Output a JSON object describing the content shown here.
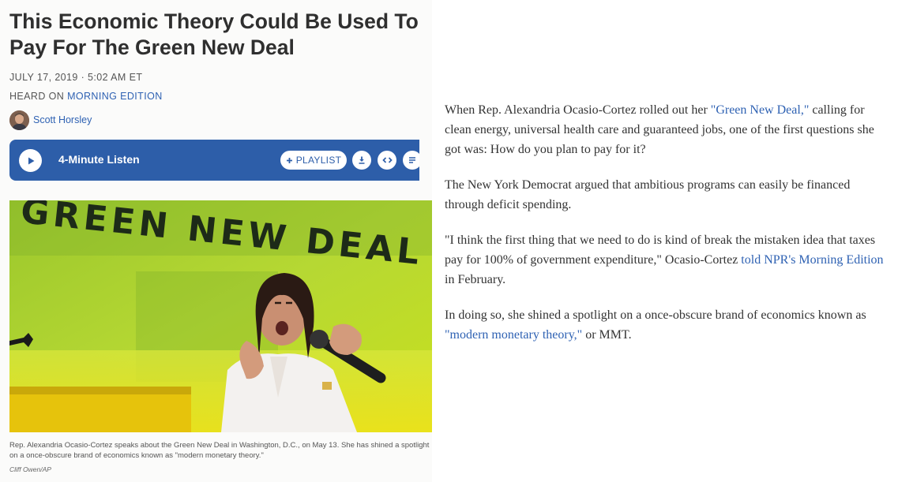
{
  "article": {
    "headline": "This Economic Theory Could Be Used To Pay For The Green New Deal",
    "dateline": "JULY 17, 2019 · 5:02 AM ET",
    "heard_on_prefix": "HEARD ON ",
    "heard_on_program": "MORNING EDITION",
    "author": "Scott Horsley"
  },
  "player": {
    "listen_label": "4-Minute Listen",
    "playlist_label": "PLAYLIST",
    "playlist_icon": "plus-icon",
    "icons": [
      "play-icon",
      "download-icon",
      "embed-icon",
      "transcript-icon"
    ]
  },
  "photo": {
    "sign_text": "GREEN NEW DEAL",
    "caption": "Rep. Alexandria Ocasio-Cortez speaks about the Green New Deal in Washington, D.C., on May 13. She has shined a spotlight on a once-obscure brand of economics known as \"modern monetary theory.\"",
    "credit": "Cliff Owen/AP"
  },
  "body": {
    "p1": {
      "before": "When Rep. Alexandria Ocasio-Cortez rolled out her ",
      "link": "\"Green New Deal,\"",
      "after": " calling for clean energy, universal health care and guaranteed jobs, one of the first questions she got was: How do you plan to pay for it?"
    },
    "p2": "The New York Democrat argued that ambitious programs can easily be financed through deficit spending.",
    "p3": {
      "before": "\"I think the first thing that we need to do is kind of break the mistaken idea that taxes pay for 100% of government expenditure,\" Ocasio-Cortez ",
      "link": "told NPR's Morning Edition",
      "after": " in February."
    },
    "p4": {
      "before": "In doing so, she shined a spotlight on a once-obscure brand of economics known as ",
      "link": "\"modern monetary theory,\"",
      "after": " or MMT."
    }
  },
  "colors": {
    "link": "#2f62b3",
    "player_bg": "#2d5ea9",
    "headline": "#2f2f2f"
  }
}
